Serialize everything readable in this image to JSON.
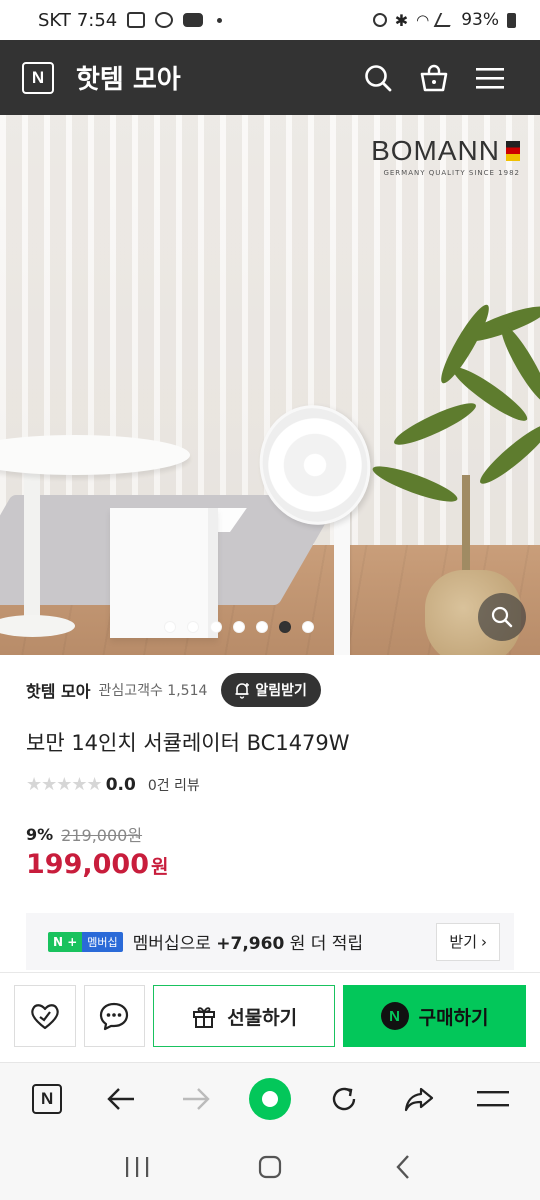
{
  "status_bar": {
    "carrier": "SKT",
    "time": "7:54",
    "battery": "93%"
  },
  "header": {
    "logo": "N",
    "title": "핫템 모아",
    "icons": [
      "search-icon",
      "shopping-bag-icon",
      "hamburger-menu-icon"
    ]
  },
  "hero": {
    "brand": "BOMANN",
    "brand_tagline": "GERMANY QUALITY SINCE 1982",
    "slide_count": 7,
    "active_slide": 6
  },
  "store": {
    "name": "핫템 모아",
    "fans_label": "관심고객수 1,514",
    "alarm_label": "알림받기"
  },
  "product": {
    "title": "보만 14인치 서큘레이터 BC1479W",
    "rating": "0.0",
    "reviews": "0건 리뷰",
    "discount_rate": "9%",
    "original_price": "219,000원",
    "sale_price": "199,000",
    "currency": "원"
  },
  "membership": {
    "badge_n": "N",
    "badge_plus": "+",
    "badge_label": "멤버십",
    "text_pre": "멤버십으로 ",
    "points": "+7,960",
    "text_post": "원 더 적립",
    "receive_label": "받기"
  },
  "actions": {
    "gift_label": "선물하기",
    "buy_label": "구매하기",
    "buy_logo": "N"
  },
  "browser_nav": {
    "logo": "N"
  },
  "colors": {
    "header_bg": "#333333",
    "price_red": "#c81d3c",
    "naver_green": "#03c75a",
    "membership_blue": "#2a6ad8"
  }
}
